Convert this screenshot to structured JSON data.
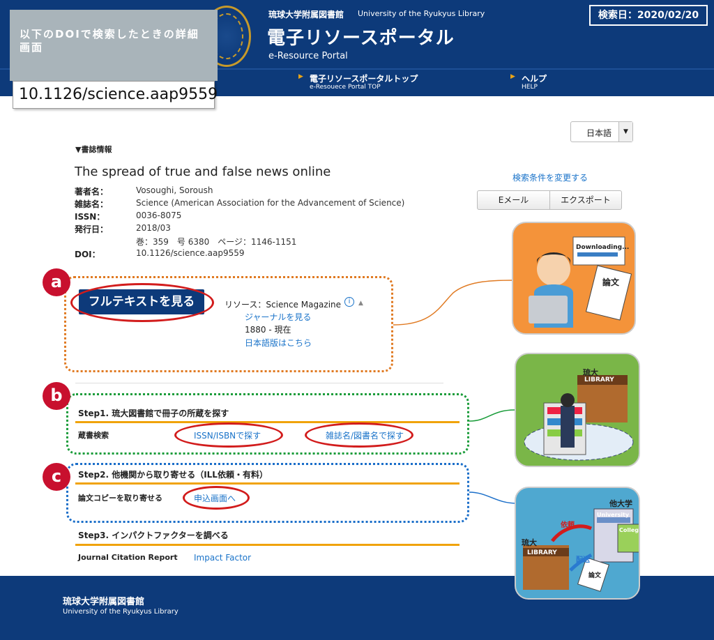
{
  "header": {
    "lib_name_ja": "琉球大学附属図書館",
    "lib_name_en": "University of the Ryukyus Library",
    "portal_title": "電子リソースポータル",
    "portal_subtitle": "e-Resource Portal",
    "search_date": "検索日：2020/02/20",
    "nav": [
      {
        "label": "電子リソースポータルトップ",
        "sub": "e-Resouece Portal TOP"
      },
      {
        "label": "ヘルプ",
        "sub": "HELP"
      }
    ]
  },
  "annotation": {
    "note": "以下のDOIで検索したときの詳細画面",
    "doi": "10.1126/science.aap9559"
  },
  "language": {
    "selected": "日本語"
  },
  "biblio": {
    "section_title": "▼書誌情報",
    "title": "The spread of true and false news online",
    "rows": [
      {
        "label": "著者名：",
        "value": "Vosoughi, Soroush"
      },
      {
        "label": "雑誌名：",
        "value": "Science (American Association for the Advancement of Science)"
      },
      {
        "label": "ISSN：",
        "value": "0036-8075"
      },
      {
        "label": "発行日：",
        "value": "2018/03"
      },
      {
        "label": "",
        "value": "巻：359　号 6380　ページ：1146-1151"
      },
      {
        "label": "DOI：",
        "value": "10.1126/science.aap9559"
      }
    ]
  },
  "actions": {
    "change_search": "検索条件を変更する",
    "email": "Eメール",
    "export": "エクスポート"
  },
  "fulltext": {
    "badge": "a",
    "button": "フルテキストを見る",
    "resource_label": "リソース：Science Magazine",
    "info_icon": "i",
    "journal_link": "ジャーナルを見る",
    "coverage": "1880 - 現在",
    "japanese_link": "日本語版はこちら"
  },
  "step1": {
    "badge": "b",
    "title": "Step1. 琉大図書館で冊子の所蔵を探す",
    "row_label": "蔵書検索",
    "link_issn": "ISSN/ISBNで探す",
    "link_title": "雑誌名/図書名で探す"
  },
  "step2": {
    "badge": "c",
    "title": "Step2. 他機関から取り寄せる（ILL依頼・有料）",
    "row_label": "論文コピーを取り寄せる",
    "link": "申込画面へ"
  },
  "step3": {
    "title": "Step3. インパクトファクターを調べる",
    "row_label": "Journal Citation Report",
    "link": "Impact Factor"
  },
  "illustrations": {
    "download": {
      "screen": "Downloading...",
      "paper": "論文"
    },
    "library": {
      "sign": "LIBRARY",
      "campus": "琉大"
    },
    "ill": {
      "other_univ": "他大学",
      "univ_sign": "University",
      "college_sign": "College",
      "lib_sign": "LIBRARY",
      "campus": "琉大",
      "request": "依頼",
      "delivery": "配送",
      "paper": "論文"
    }
  },
  "footer": {
    "name_ja": "琉球大学附属図書館",
    "name_en": "University of the Ryukyus Library"
  }
}
